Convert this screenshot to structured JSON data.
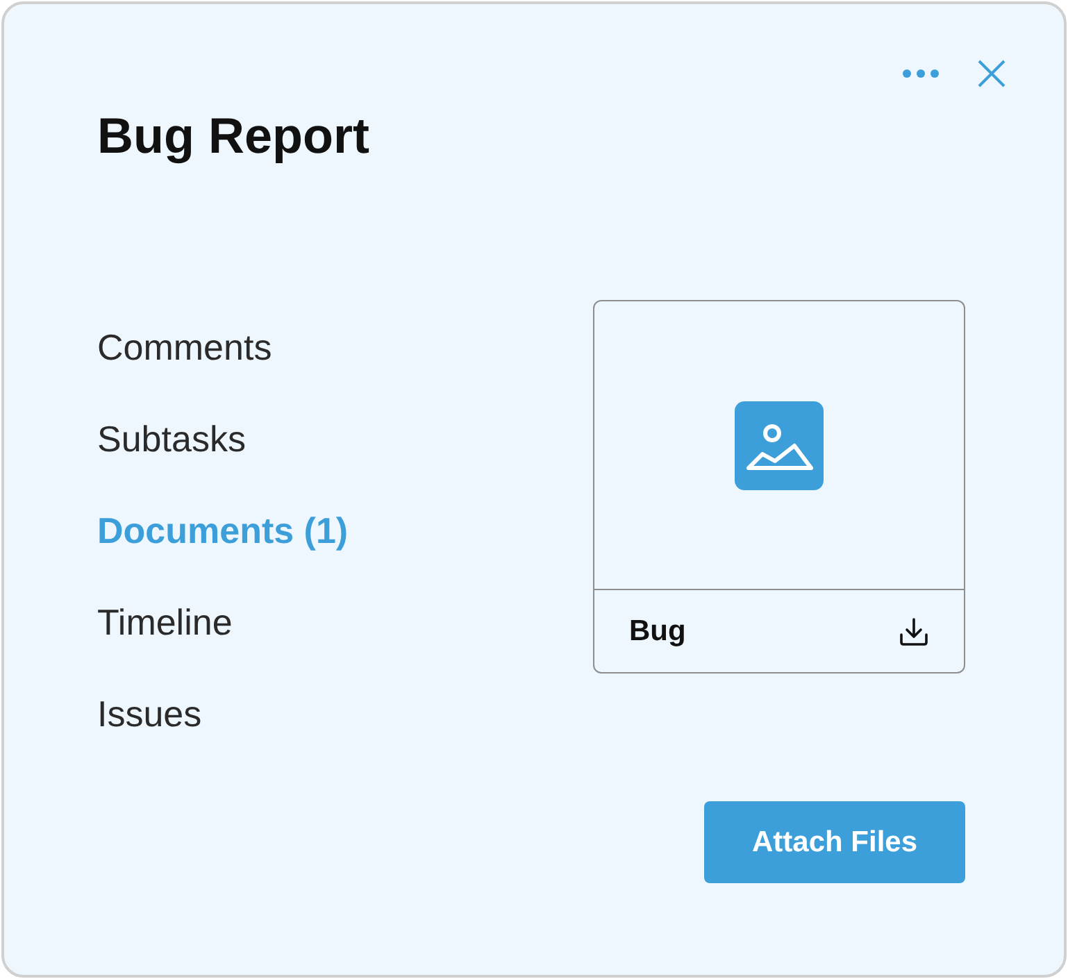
{
  "window": {
    "title": "Bug Report"
  },
  "nav": [
    {
      "label": "Comments",
      "selected": false
    },
    {
      "label": "Subtasks",
      "selected": false
    },
    {
      "label": "Documents (1)",
      "selected": true
    },
    {
      "label": "Timeline",
      "selected": false
    },
    {
      "label": "Issues",
      "selected": false
    }
  ],
  "document": {
    "name": "Bug"
  },
  "attach_button": {
    "label": "Attach Files"
  }
}
